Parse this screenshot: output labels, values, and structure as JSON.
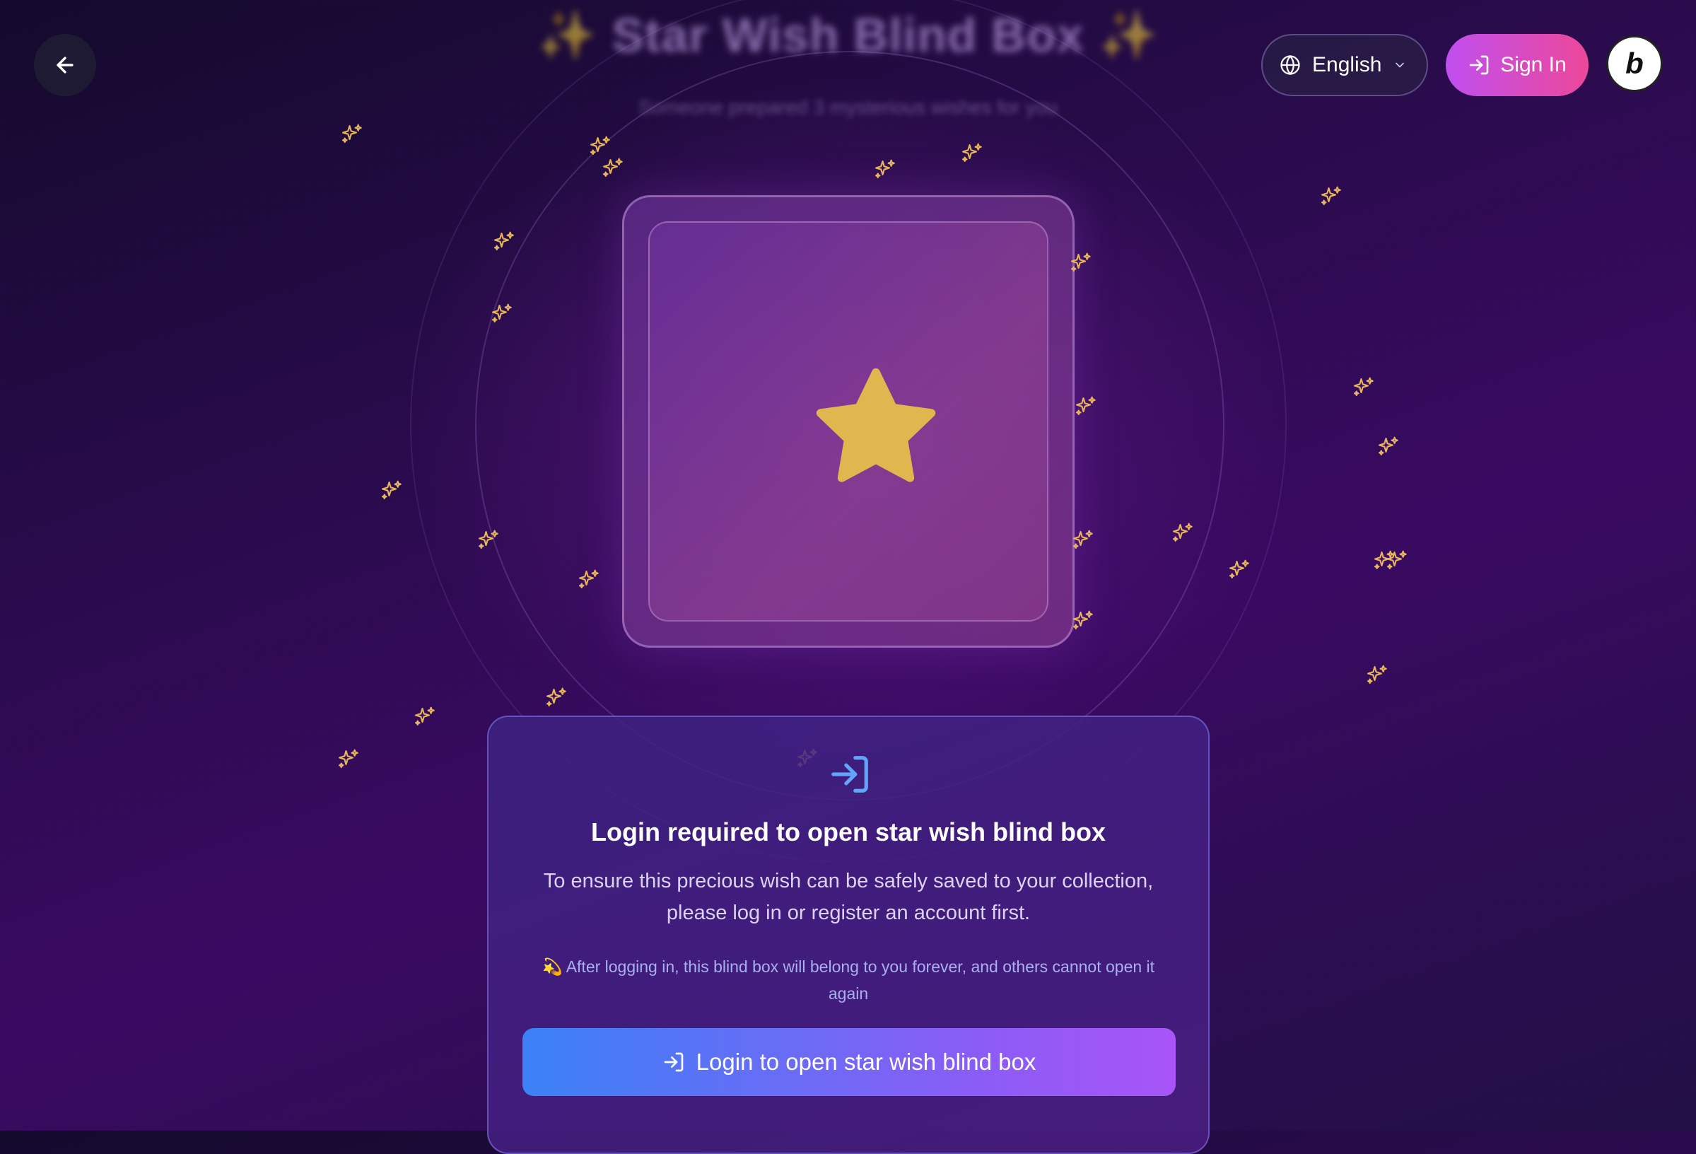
{
  "header": {
    "title": "✨ Star Wish Blind Box ✨",
    "subtitle": "Someone prepared 3 mysterious wishes for you",
    "language": "English",
    "sign_in_label": "Sign In",
    "badge_letter": "b"
  },
  "icons": {
    "back": "arrow-left-icon",
    "globe": "globe-icon",
    "chevron": "chevron-down-icon",
    "login": "log-in-icon",
    "star": "star-icon",
    "sparkle": "sparkles-icon"
  },
  "colors": {
    "star": "#e0b64f",
    "sparkle": "#e7b65a",
    "signin_start": "#c04ff0",
    "signin_end": "#ec4899",
    "button_start": "#3b82f6",
    "button_end": "#a855f7",
    "login_icon": "#60a5fa"
  },
  "login_card": {
    "title": "Login required to open star wish blind box",
    "description": "To ensure this precious wish can be safely saved to your collection, please log in or register an account first.",
    "note": "💫 After logging in, this blind box will belong to you forever, and others cannot open it again",
    "button_label": "Login to open star wish blind box"
  }
}
